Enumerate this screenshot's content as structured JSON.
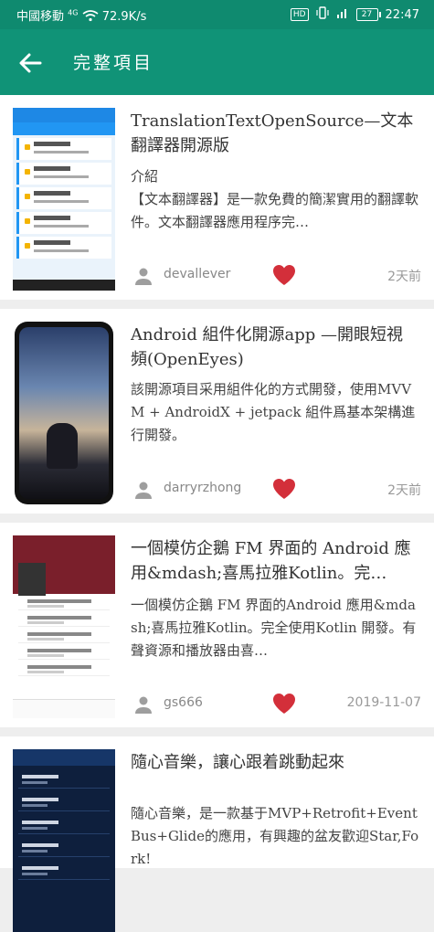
{
  "status_bar": {
    "carrier": "中國移動",
    "network": "4G",
    "speed": "72.9K/s",
    "hd_badge": "HD",
    "battery": "27",
    "time": "22:47"
  },
  "app_bar": {
    "title": "完整項目"
  },
  "projects": [
    {
      "title": "TranslationTextOpenSource—文本翻譯器開源版",
      "description": "介紹\n【文本翻譯器】是一款免費的簡潔實用的翻譯軟件。文本翻譯器應用程序完…",
      "author": "devallever",
      "time": "2天前"
    },
    {
      "title": "Android 組件化開源app —開眼短視頻(OpenEyes)",
      "description": "該開源項目采用組件化的方式開發，使用MVVM + AndroidX + jetpack 組件爲基本架構進行開發。",
      "author": "darryrzhong",
      "time": "2天前"
    },
    {
      "title": "一個模仿企鵝 FM 界面的 Android 應用&mdash;喜馬拉雅Kotlin。完…",
      "description": "一個模仿企鵝 FM 界面的Android 應用&mdash;喜馬拉雅Kotlin。完全使用Kotlin 開發。有聲資源和播放器由喜…",
      "author": "gs666",
      "time": "2019-11-07"
    },
    {
      "title": "隨心音樂，讓心跟着跳動起來",
      "description": "隨心音樂，是一款基于MVP+Retrofit+EventBus+Glide的應用，有興趣的盆友歡迎Star,Fork!",
      "author": "",
      "time": ""
    }
  ],
  "colors": {
    "status_bar": "#0f8a6f",
    "app_bar": "#109377",
    "favorite": "#d32f3a"
  }
}
